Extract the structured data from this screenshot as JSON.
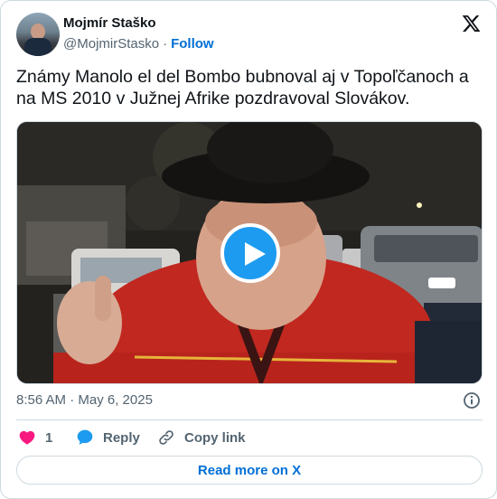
{
  "author": {
    "name": "Mojmír Staško",
    "handle": "@MojmirStasko",
    "separator": "·",
    "follow_label": "Follow"
  },
  "tweet": {
    "text": "Známy Manolo el del Bombo bubnoval aj v Topoľčanoch a na MS 2010 v Južnej Afrike pozdravoval Slovákov.",
    "timestamp": "8:56 AM · May 6, 2025"
  },
  "media": {
    "type": "video",
    "play_icon": "play-icon"
  },
  "actions": {
    "like_count": "1",
    "reply_label": "Reply",
    "copy_link_label": "Copy link"
  },
  "footer": {
    "read_more_label": "Read more on X"
  },
  "colors": {
    "accent": "#1d9bf0",
    "link": "#006fd6",
    "like": "#f91880",
    "secondary_text": "#536471",
    "border": "#cfd9de"
  },
  "icons": [
    "x-logo-icon",
    "info-icon",
    "heart-icon",
    "reply-bubble-icon",
    "link-icon",
    "play-icon"
  ]
}
